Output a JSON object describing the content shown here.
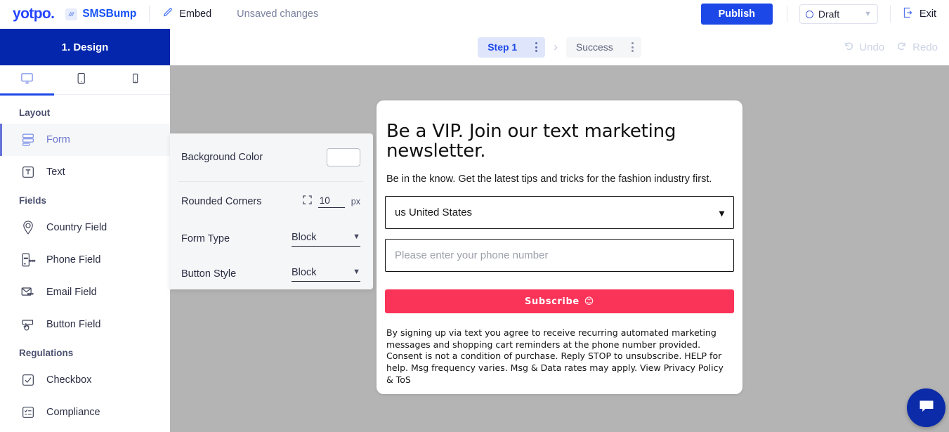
{
  "topbar": {
    "logo": "yotpo.",
    "app_icon": "smsbump-icon",
    "app_name": "SMSBump",
    "embed_icon": "pencil-icon",
    "embed_label": "Embed",
    "save_status": "Unsaved changes",
    "publish_label": "Publish",
    "status_dot_icon": "circle-icon",
    "status_value": "Draft",
    "status_caret_icon": "chevron-down-icon",
    "exit_icon": "exit-arrow-icon",
    "exit_label": "Exit"
  },
  "sidebar": {
    "header": "1. Design",
    "devices": [
      {
        "name": "desktop",
        "icon": "monitor-icon",
        "active": true
      },
      {
        "name": "tablet",
        "icon": "tablet-icon",
        "active": false
      },
      {
        "name": "mobile",
        "icon": "mobile-icon",
        "active": false
      }
    ],
    "groups": [
      {
        "title": "Layout",
        "items": [
          {
            "label": "Form",
            "icon": "form-icon",
            "active": true
          },
          {
            "label": "Text",
            "icon": "text-box-icon",
            "active": false
          }
        ]
      },
      {
        "title": "Fields",
        "items": [
          {
            "label": "Country Field",
            "icon": "map-pin-icon",
            "active": false
          },
          {
            "label": "Phone Field",
            "icon": "phone-field-icon",
            "active": false
          },
          {
            "label": "Email Field",
            "icon": "envelope-icon",
            "active": false
          },
          {
            "label": "Button Field",
            "icon": "click-button-icon",
            "active": false
          }
        ]
      },
      {
        "title": "Regulations",
        "items": [
          {
            "label": "Checkbox",
            "icon": "checkbox-icon",
            "active": false
          },
          {
            "label": "Compliance",
            "icon": "checklist-icon",
            "active": false
          }
        ]
      }
    ]
  },
  "stepbar": {
    "steps": [
      {
        "label": "Step 1",
        "active": true
      },
      {
        "label": "Success",
        "active": false
      }
    ],
    "arrow_icon": "chevron-right-icon",
    "kebab_icon": "vertical-dots-icon",
    "undo": {
      "icon": "undo-arrow-icon",
      "label": "Undo"
    },
    "redo": {
      "icon": "redo-arrow-icon",
      "label": "Redo"
    }
  },
  "settings": {
    "background_color_label": "Background Color",
    "background_color_value": "#ffffff",
    "rounded_corners_label": "Rounded Corners",
    "rounded_corners_icon": "corner-radius-icon",
    "rounded_corners_value": "10",
    "rounded_corners_unit": "px",
    "form_type_label": "Form Type",
    "form_type_value": "Block",
    "button_style_label": "Button Style",
    "button_style_value": "Block",
    "caret_icon": "chevron-down-icon"
  },
  "form_preview": {
    "title": "Be a VIP. Join our text marketing newsletter.",
    "subtitle": "Be in the know. Get the latest tips and tricks for the fashion industry first.",
    "country_value": "us United States",
    "country_caret_icon": "chevron-down-icon",
    "phone_placeholder": "Please enter your phone number",
    "submit_label": "Subscribe",
    "submit_emoji": "😊",
    "submit_color": "#fa3358",
    "legal": "By signing up via text you agree to receive recurring automated marketing messages and shopping cart reminders at the phone number provided. Consent is not a condition of purchase. Reply STOP to unsubscribe. HELP for help. Msg frequency varies. Msg & Data rates may apply. View Privacy Policy & ToS"
  },
  "chat": {
    "icon": "chat-bubble-icon"
  },
  "colors": {
    "brand_blue": "#1d48e8",
    "design_header": "#0326ac",
    "canvas_gray": "#b4b4b4",
    "panel_gray": "#f5f6f7",
    "accent_pink": "#fa3358"
  }
}
